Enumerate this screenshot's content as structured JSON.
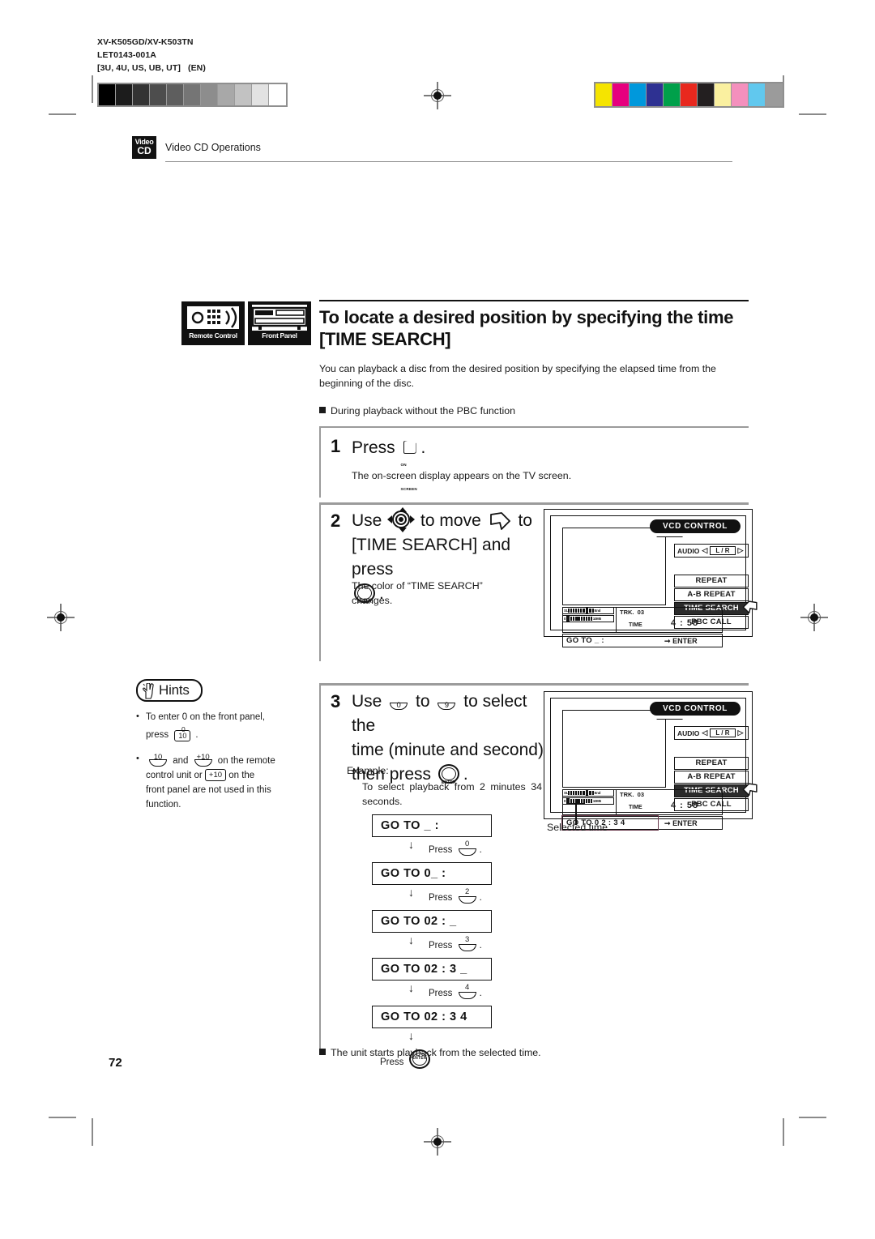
{
  "meta": {
    "model_codes": "XV-K505GD/XV-K503TN",
    "doc_number": "LET0143-001A",
    "region_codes": "[3U, 4U, US, UB, UT]   (EN)",
    "page_number": "72"
  },
  "running_head": {
    "badge_line1": "Video",
    "badge_line2": "CD",
    "title": "Video CD Operations"
  },
  "section": {
    "icon_remote_label": "Remote Control",
    "icon_front_label": "Front Panel",
    "heading_line1": "To locate a desired position by specifying the time",
    "heading_line2": "[TIME SEARCH]",
    "intro": "You can playback a disc from the desired position by specifying the elapsed time from the beginning of the disc.",
    "subhead": "During playback without the PBC function"
  },
  "steps": [
    {
      "number": "1",
      "text_before": "Press",
      "key": "ON SCREEN",
      "text_after": ".",
      "note": "The on-screen display appears on the TV screen."
    },
    {
      "number": "2",
      "line1_a": "Use",
      "line1_b": "to move",
      "line1_c": "to",
      "line2": "[TIME SEARCH] and press",
      "line3": ".",
      "note_line1": "The color of “TIME SEARCH”",
      "note_line2": "changes."
    },
    {
      "number": "3",
      "line1_a": "Use",
      "line1_b": "to",
      "line1_c": "to select the",
      "line2": "time (minute and second)",
      "line3": "then press",
      "example_label": "Example:",
      "example_text": "To select playback from 2 minutes 34 seconds."
    }
  ],
  "hints": {
    "title": "Hints",
    "items": [
      {
        "part1": "To enter 0 on the front panel,",
        "part2": "press",
        "key_top": "0",
        "key_body": "10",
        "part3": "."
      },
      {
        "key1_label": "10",
        "mid": "and",
        "key2_label": "+10",
        "part2": "on the remote",
        "part3": "control unit or",
        "key3_label": "+10",
        "part4": "on the",
        "part5": "front panel are not used in this",
        "part6": "function."
      }
    ]
  },
  "goto_flow": {
    "steps": [
      {
        "display": "GO TO _   :",
        "press_label": "Press",
        "press_key": "0",
        "press_period": "."
      },
      {
        "display": "GO TO 0_ :",
        "press_label": "Press",
        "press_key": "2",
        "press_period": "."
      },
      {
        "display": "GO TO 02 : _",
        "press_label": "Press",
        "press_key": "3",
        "press_period": "."
      },
      {
        "display": "GO TO 02 : 3 _",
        "press_label": "Press",
        "press_key": "4",
        "press_period": "."
      },
      {
        "display": "GO TO 02 : 3 4",
        "press_label": "Press",
        "press_key": "ENTER",
        "press_period": ""
      }
    ],
    "final_press_label": "Press",
    "final_press_key": "ENTER",
    "selected_time_caption": "Selected time"
  },
  "final_note": "The unit starts playback from the selected time.",
  "vcd_panel_1": {
    "title": "VCD CONTROL",
    "audio_label": "AUDIO",
    "audio_value": "L / R",
    "buttons": [
      {
        "label": "REPEAT",
        "selected": false
      },
      {
        "label": "A-B REPEAT",
        "selected": false
      },
      {
        "label": "TIME SEARCH",
        "selected": true
      },
      {
        "label": "PBC CALL",
        "selected": false
      }
    ],
    "bar_start_label": "St.",
    "bar_end_label": "End",
    "bar2_left_label": "0",
    "bar2_right_label": "10M5",
    "trk_label": "TRK.",
    "trk_value": "03",
    "time_label": "TIME",
    "time_value": "4 : 58",
    "goto_label": "GO TO _   :",
    "enter_label": "ENTER"
  },
  "vcd_panel_2": {
    "title": "VCD CONTROL",
    "audio_label": "AUDIO",
    "audio_value": "L / R",
    "buttons": [
      {
        "label": "REPEAT",
        "selected": false
      },
      {
        "label": "A-B REPEAT",
        "selected": false
      },
      {
        "label": "TIME SEARCH",
        "selected": true
      },
      {
        "label": "PBC CALL",
        "selected": false
      }
    ],
    "bar_start_label": "St.",
    "bar_end_label": "End",
    "bar2_left_label": "0",
    "bar2_right_label": "10M5",
    "trk_label": "TRK.",
    "trk_value": "03",
    "time_label": "TIME",
    "time_value": "4 : 58",
    "goto_label": "GO TO 0 2 : 3 4",
    "enter_label": "ENTER"
  },
  "colors": {
    "gray_wedge": [
      "#000000",
      "#1c1c1c",
      "#333333",
      "#4d4d4d",
      "#5e5e5e",
      "#757575",
      "#8d8d8d",
      "#a8a8a8",
      "#c2c2c2",
      "#e2e2e2",
      "#ffffff"
    ],
    "color_bar": [
      "#f5e400",
      "#e6007e",
      "#0098dc",
      "#2e3192",
      "#00a04a",
      "#e8281e",
      "#231f20",
      "#faf0a0",
      "#f490bd",
      "#61c8ee",
      "#9b9b9b"
    ],
    "highlight_box": "#6b3b4e",
    "selected_button_bg": "#2b2b2b"
  }
}
